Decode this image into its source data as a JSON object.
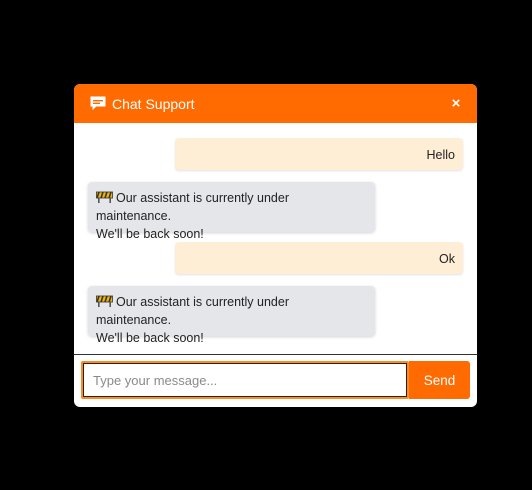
{
  "header": {
    "icon": "chat-bubble-icon",
    "title": "Chat Support",
    "close_label": "×"
  },
  "messages": [
    {
      "sender": "user",
      "text": "Hello"
    },
    {
      "sender": "bot",
      "icon": "construction-barrier-icon",
      "line1": "Our assistant is currently under maintenance.",
      "line2": "We'll be back soon!"
    },
    {
      "sender": "user",
      "text": "Ok"
    },
    {
      "sender": "bot",
      "icon": "construction-barrier-icon",
      "line1": "Our assistant is currently under maintenance.",
      "line2": "We'll be back soon!"
    }
  ],
  "composer": {
    "placeholder": "Type your message...",
    "value": "",
    "send_label": "Send"
  },
  "colors": {
    "accent": "#ff6b00",
    "user_bubble": "#ffeed6",
    "bot_bubble": "#e5e6ea"
  }
}
